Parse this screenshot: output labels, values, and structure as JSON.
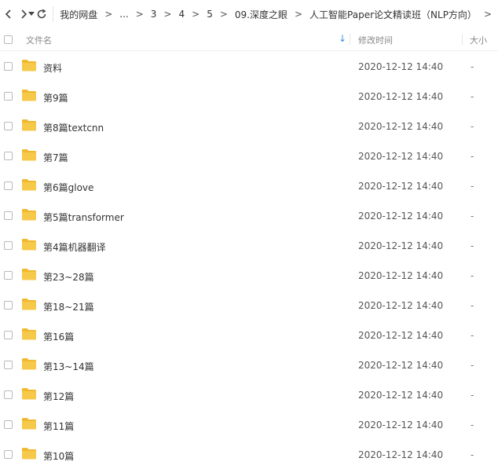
{
  "toolbar": {
    "back_icon": "chevron-left-icon",
    "forward_icon": "chevron-right-icon",
    "dropdown_icon": "caret-down-icon",
    "refresh_icon": "refresh-icon",
    "breadcrumb": [
      "我的网盘",
      "...",
      "3",
      "4",
      "5",
      "09.深度之眼",
      "人工智能Paper论文精读班（NLP方向）"
    ],
    "separator": ">"
  },
  "header": {
    "name": "文件名",
    "sort_icon": "↓",
    "mtime": "修改时间",
    "size": "大小"
  },
  "files": [
    {
      "name": "资料",
      "mtime": "2020-12-12 14:40",
      "size": "-"
    },
    {
      "name": "第9篇",
      "mtime": "2020-12-12 14:40",
      "size": "-"
    },
    {
      "name": "第8篇textcnn",
      "mtime": "2020-12-12 14:40",
      "size": "-"
    },
    {
      "name": "第7篇",
      "mtime": "2020-12-12 14:40",
      "size": "-"
    },
    {
      "name": "第6篇glove",
      "mtime": "2020-12-12 14:40",
      "size": "-"
    },
    {
      "name": "第5篇transformer",
      "mtime": "2020-12-12 14:40",
      "size": "-"
    },
    {
      "name": "第4篇机器翻译",
      "mtime": "2020-12-12 14:40",
      "size": "-"
    },
    {
      "name": "第23~28篇",
      "mtime": "2020-12-12 14:40",
      "size": "-"
    },
    {
      "name": "第18~21篇",
      "mtime": "2020-12-12 14:40",
      "size": "-"
    },
    {
      "name": "第16篇",
      "mtime": "2020-12-12 14:40",
      "size": "-"
    },
    {
      "name": "第13~14篇",
      "mtime": "2020-12-12 14:40",
      "size": "-"
    },
    {
      "name": "第12篇",
      "mtime": "2020-12-12 14:40",
      "size": "-"
    },
    {
      "name": "第11篇",
      "mtime": "2020-12-12 14:40",
      "size": "-"
    },
    {
      "name": "第10篇",
      "mtime": "2020-12-12 14:40",
      "size": "-"
    }
  ],
  "colors": {
    "folder": "#f7c94a",
    "folder_tab": "#f0b92e",
    "sort_accent": "#3a8ee6"
  }
}
